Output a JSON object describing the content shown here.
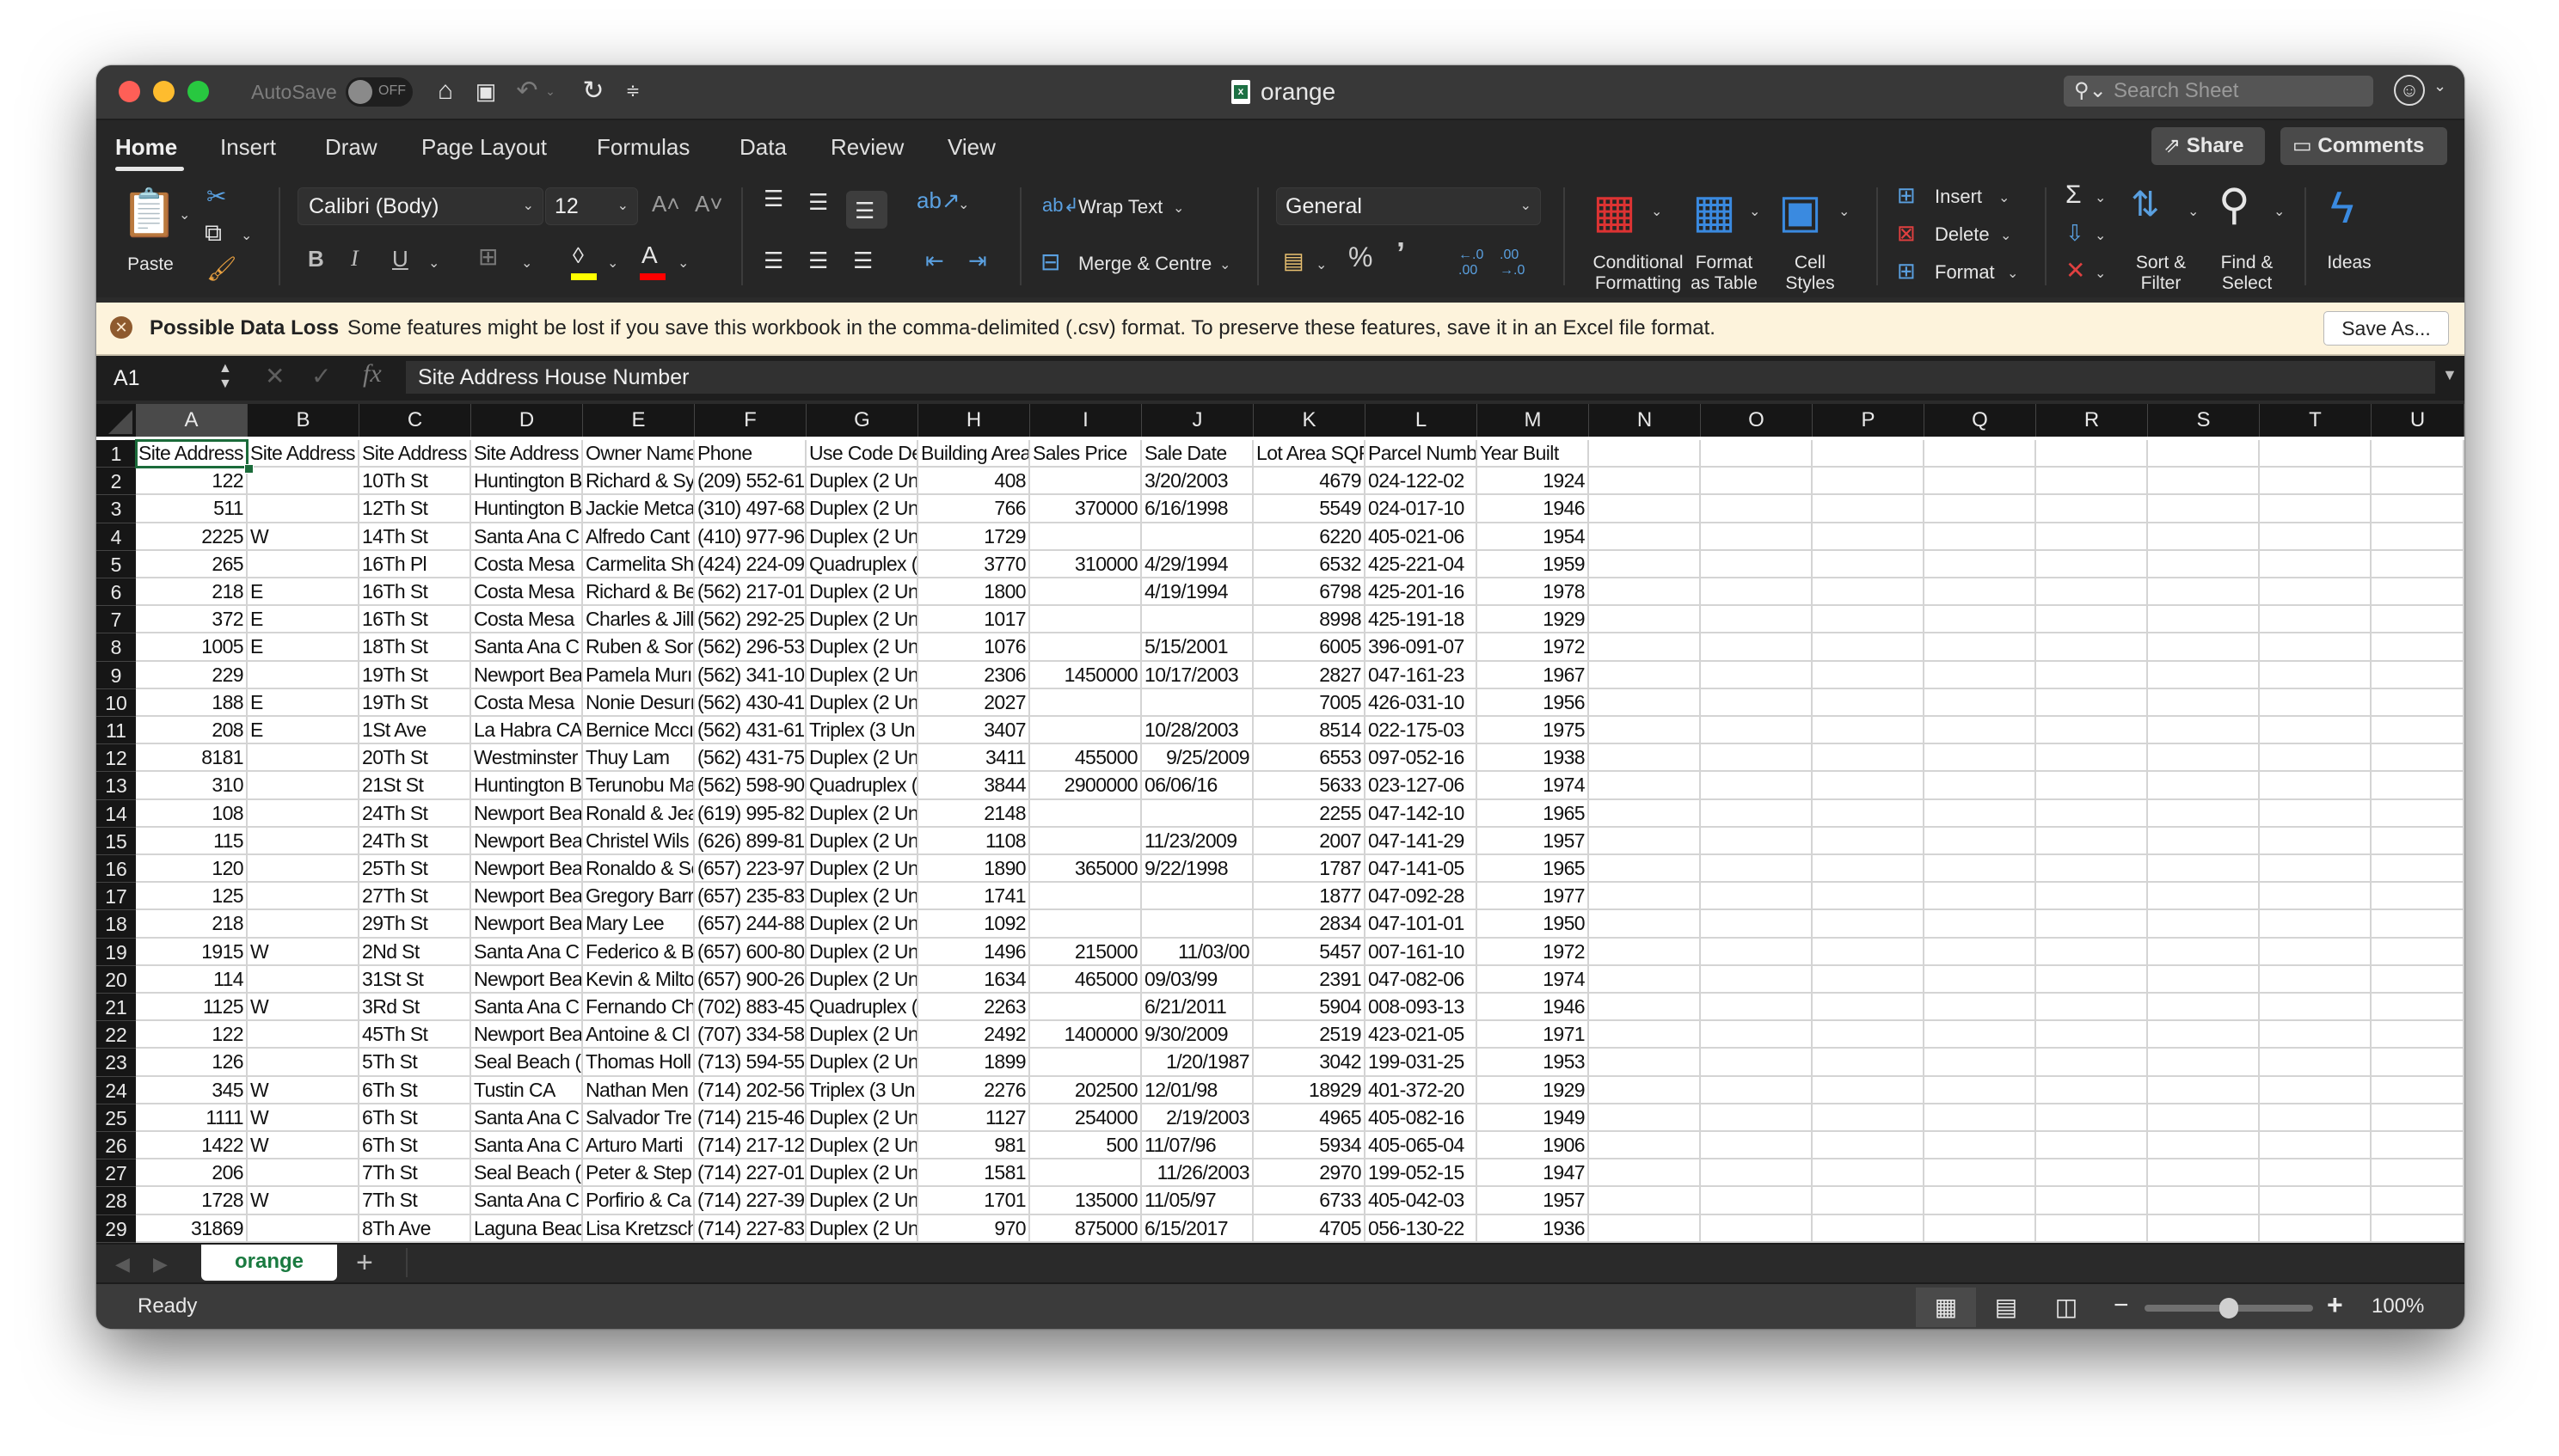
{
  "window": {
    "title": "orange",
    "autosave_label": "AutoSave",
    "autosave_state": "OFF",
    "search_placeholder": "Search Sheet"
  },
  "ribbon_tabs": [
    {
      "label": "Home",
      "active": true
    },
    {
      "label": "Insert"
    },
    {
      "label": "Draw"
    },
    {
      "label": "Page Layout"
    },
    {
      "label": "Formulas"
    },
    {
      "label": "Data"
    },
    {
      "label": "Review"
    },
    {
      "label": "View"
    }
  ],
  "header_buttons": {
    "share": "Share",
    "comments": "Comments"
  },
  "ribbon": {
    "paste": "Paste",
    "font_name": "Calibri (Body)",
    "font_size": "12",
    "bold": "B",
    "italic": "I",
    "underline": "U",
    "wrap_text": "Wrap Text",
    "merge_centre": "Merge & Centre",
    "number_format": "General",
    "percent": "%",
    "comma": "’",
    "conditional_formatting": [
      "Conditional",
      "Formatting"
    ],
    "format_as_table": [
      "Format",
      "as Table"
    ],
    "cell_styles": [
      "Cell",
      "Styles"
    ],
    "insert": "Insert",
    "delete": "Delete",
    "format": "Format",
    "sort_filter": [
      "Sort &",
      "Filter"
    ],
    "find_select": [
      "Find &",
      "Select"
    ],
    "ideas": "Ideas",
    "colors": {
      "highlight": "#ffff00",
      "font_color": "#ff0000"
    }
  },
  "infobar": {
    "title": "Possible Data Loss",
    "message": "Some features might be lost if you save this workbook in the comma-delimited (.csv) format. To preserve these features, save it in an Excel file format.",
    "button": "Save As..."
  },
  "formula_bar": {
    "name_box": "A1",
    "content": "Site Address House Number"
  },
  "grid": {
    "selected_cell": "A1",
    "columns": [
      "A",
      "B",
      "C",
      "D",
      "E",
      "F",
      "G",
      "H",
      "I",
      "J",
      "K",
      "L",
      "M",
      "N",
      "O",
      "P",
      "Q",
      "R",
      "S",
      "T",
      "U"
    ],
    "numeric_columns": [
      0,
      7,
      8,
      10,
      12
    ],
    "rows": [
      [
        "Site Address",
        "Site Address",
        "Site Address",
        "Site Address",
        "Owner Name",
        "Phone",
        "Use Code De",
        "Building Area",
        "Sales Price",
        "Sale Date",
        "Lot Area SQF",
        "Parcel Numb",
        "Year Built"
      ],
      [
        "122",
        "",
        "10Th St",
        "Huntington B",
        "Richard & Sy",
        "(209) 552-61",
        "Duplex (2 Un",
        "408",
        "",
        "3/20/2003",
        "4679",
        "024-122-02",
        "1924"
      ],
      [
        "511",
        "",
        "12Th St",
        "Huntington B",
        "Jackie Metca",
        "(310) 497-68",
        "Duplex (2 Un",
        "766",
        "370000",
        "6/16/1998",
        "5549",
        "024-017-10",
        "1946"
      ],
      [
        "2225",
        "W",
        "14Th St",
        "Santa Ana  C",
        "Alfredo Cant",
        "(410) 977-96",
        "Duplex (2 Un",
        "1729",
        "",
        "",
        "6220",
        "405-021-06",
        "1954"
      ],
      [
        "265",
        "",
        "16Th Pl",
        "Costa Mesa",
        "Carmelita Sh",
        "(424) 224-09",
        "Quadruplex (",
        "3770",
        "310000",
        "4/29/1994",
        "6532",
        "425-221-04",
        "1959"
      ],
      [
        "218",
        "E",
        "16Th St",
        "Costa Mesa",
        "Richard & Be",
        "(562) 217-01",
        "Duplex (2 Un",
        "1800",
        "",
        "4/19/1994",
        "6798",
        "425-201-16",
        "1978"
      ],
      [
        "372",
        "E",
        "16Th St",
        "Costa Mesa",
        "Charles & Jill",
        "(562) 292-25",
        "Duplex (2 Un",
        "1017",
        "",
        "",
        "8998",
        "425-191-18",
        "1929"
      ],
      [
        "1005",
        "E",
        "18Th St",
        "Santa Ana  C",
        "Ruben & Son",
        "(562) 296-53",
        "Duplex (2 Un",
        "1076",
        "",
        "5/15/2001",
        "6005",
        "396-091-07",
        "1972"
      ],
      [
        "229",
        "",
        "19Th St",
        "Newport Bea",
        "Pamela Murı",
        "(562) 341-10",
        "Duplex (2 Un",
        "2306",
        "1450000",
        "10/17/2003",
        "2827",
        "047-161-23",
        "1967"
      ],
      [
        "188",
        "E",
        "19Th St",
        "Costa Mesa",
        "Nonie Desurı",
        "(562) 430-41",
        "Duplex (2 Un",
        "2027",
        "",
        "",
        "7005",
        "426-031-10",
        "1956"
      ],
      [
        "208",
        "E",
        "1St Ave",
        "La Habra  CA",
        "Bernice Mccı",
        "(562) 431-61",
        "Triplex (3 Un",
        "3407",
        "",
        "10/28/2003",
        "8514",
        "022-175-03",
        "1975"
      ],
      [
        "8181",
        "",
        "20Th St",
        "Westminster",
        "Thuy Lam",
        "(562) 431-75",
        "Duplex (2 Un",
        "3411",
        "455000",
        "9/25/2009",
        "6553",
        "097-052-16",
        "1938"
      ],
      [
        "310",
        "",
        "21St St",
        "Huntington B",
        "Terunobu Ma",
        "(562) 598-90",
        "Quadruplex (",
        "3844",
        "2900000",
        "06/06/16",
        "5633",
        "023-127-06",
        "1974"
      ],
      [
        "108",
        "",
        "24Th St",
        "Newport Bea",
        "Ronald & Jea",
        "(619) 995-82",
        "Duplex (2 Un",
        "2148",
        "",
        "",
        "2255",
        "047-142-10",
        "1965"
      ],
      [
        "115",
        "",
        "24Th St",
        "Newport Bea",
        "Christel Wils",
        "(626) 899-81",
        "Duplex (2 Un",
        "1108",
        "",
        "11/23/2009",
        "2007",
        "047-141-29",
        "1957"
      ],
      [
        "120",
        "",
        "25Th St",
        "Newport Bea",
        "Ronaldo & Se",
        "(657) 223-97",
        "Duplex (2 Un",
        "1890",
        "365000",
        "9/22/1998",
        "1787",
        "047-141-05",
        "1965"
      ],
      [
        "125",
        "",
        "27Th St",
        "Newport Bea",
        "Gregory Barr",
        "(657) 235-83",
        "Duplex (2 Un",
        "1741",
        "",
        "",
        "1877",
        "047-092-28",
        "1977"
      ],
      [
        "218",
        "",
        "29Th St",
        "Newport Bea",
        "Mary Lee",
        "(657) 244-88",
        "Duplex (2 Un",
        "1092",
        "",
        "",
        "2834",
        "047-101-01",
        "1950"
      ],
      [
        "1915",
        "W",
        "2Nd St",
        "Santa Ana  C",
        "Federico & B",
        "(657) 600-80",
        "Duplex (2 Un",
        "1496",
        "215000",
        "11/03/00",
        "5457",
        "007-161-10",
        "1972"
      ],
      [
        "114",
        "",
        "31St St",
        "Newport Bea",
        "Kevin & Milto",
        "(657) 900-26",
        "Duplex (2 Un",
        "1634",
        "465000",
        "09/03/99",
        "2391",
        "047-082-06",
        "1974"
      ],
      [
        "1125",
        "W",
        "3Rd St",
        "Santa Ana  C",
        "Fernando Ch",
        "(702) 883-45",
        "Quadruplex (",
        "2263",
        "",
        "6/21/2011",
        "5904",
        "008-093-13",
        "1946"
      ],
      [
        "122",
        "",
        "45Th St",
        "Newport Bea",
        "Antoine & Cl",
        "(707) 334-58",
        "Duplex (2 Un",
        "2492",
        "1400000",
        "9/30/2009",
        "2519",
        "423-021-05",
        "1971"
      ],
      [
        "126",
        "",
        "5Th St",
        "Seal Beach  (",
        "Thomas Holl",
        "(713) 594-55",
        "Duplex (2 Un",
        "1899",
        "",
        "1/20/1987",
        "3042",
        "199-031-25",
        "1953"
      ],
      [
        "345",
        "W",
        "6Th St",
        "Tustin  CA",
        "Nathan Men",
        "(714) 202-56",
        "Triplex (3 Un",
        "2276",
        "202500",
        "12/01/98",
        "18929",
        "401-372-20",
        "1929"
      ],
      [
        "1111",
        "W",
        "6Th St",
        "Santa Ana  C",
        "Salvador Tre",
        "(714) 215-46",
        "Duplex (2 Un",
        "1127",
        "254000",
        "2/19/2003",
        "4965",
        "405-082-16",
        "1949"
      ],
      [
        "1422",
        "W",
        "6Th St",
        "Santa Ana  C",
        "Arturo Marti",
        "(714) 217-12",
        "Duplex (2 Un",
        "981",
        "500",
        "11/07/96",
        "5934",
        "405-065-04",
        "1906"
      ],
      [
        "206",
        "",
        "7Th St",
        "Seal Beach  (",
        "Peter & Step",
        "(714) 227-01",
        "Duplex (2 Un",
        "1581",
        "",
        "11/26/2003",
        "2970",
        "199-052-15",
        "1947"
      ],
      [
        "1728",
        "W",
        "7Th St",
        "Santa Ana  C",
        "Porfirio & Ca",
        "(714) 227-39",
        "Duplex (2 Un",
        "1701",
        "135000",
        "11/05/97",
        "6733",
        "405-042-03",
        "1957"
      ],
      [
        "31869",
        "",
        "8Th Ave",
        "Laguna Beac",
        "Lisa Kretzsch",
        "(714) 227-83",
        "Duplex (2 Un",
        "970",
        "875000",
        "6/15/2017",
        "4705",
        "056-130-22",
        "1936"
      ]
    ],
    "right_aligned_dates_rows": [
      12,
      18,
      19,
      23,
      25,
      27
    ]
  },
  "sheet_tabs": [
    {
      "label": "orange",
      "active": true
    }
  ],
  "status": {
    "text": "Ready",
    "zoom": "100%",
    "zoom_slider_fraction": 0.5
  }
}
